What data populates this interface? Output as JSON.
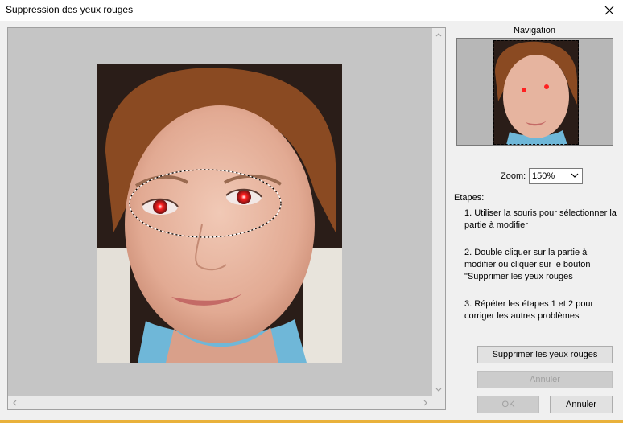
{
  "window": {
    "title": "Suppression des yeux rouges"
  },
  "navigation": {
    "label": "Navigation"
  },
  "zoom": {
    "label": "Zoom:",
    "value": "150%"
  },
  "steps": {
    "title": "Etapes:",
    "items": [
      "1. Utiliser la souris pour sélectionner la partie à modifier",
      "2. Double cliquer sur la partie à modifier ou cliquer sur le bouton \"Supprimer les yeux rouges",
      "3. Répéter les étapes 1 et 2 pour corriger les autres problèmes"
    ]
  },
  "buttons": {
    "remove_red_eye": "Supprimer les yeux rouges",
    "undo": "Annuler",
    "ok": "OK",
    "cancel": "Annuler"
  },
  "icons": {
    "close": "close-icon",
    "scroll_up": "chevron-up-icon",
    "scroll_down": "chevron-down-icon",
    "scroll_left": "chevron-left-icon",
    "scroll_right": "chevron-right-icon",
    "zoom_dropdown": "chevron-down-icon"
  },
  "colors": {
    "accent_strip": "#e9b13b",
    "viewport_bg": "#c5c5c5",
    "red_eye": "#ff2020"
  }
}
